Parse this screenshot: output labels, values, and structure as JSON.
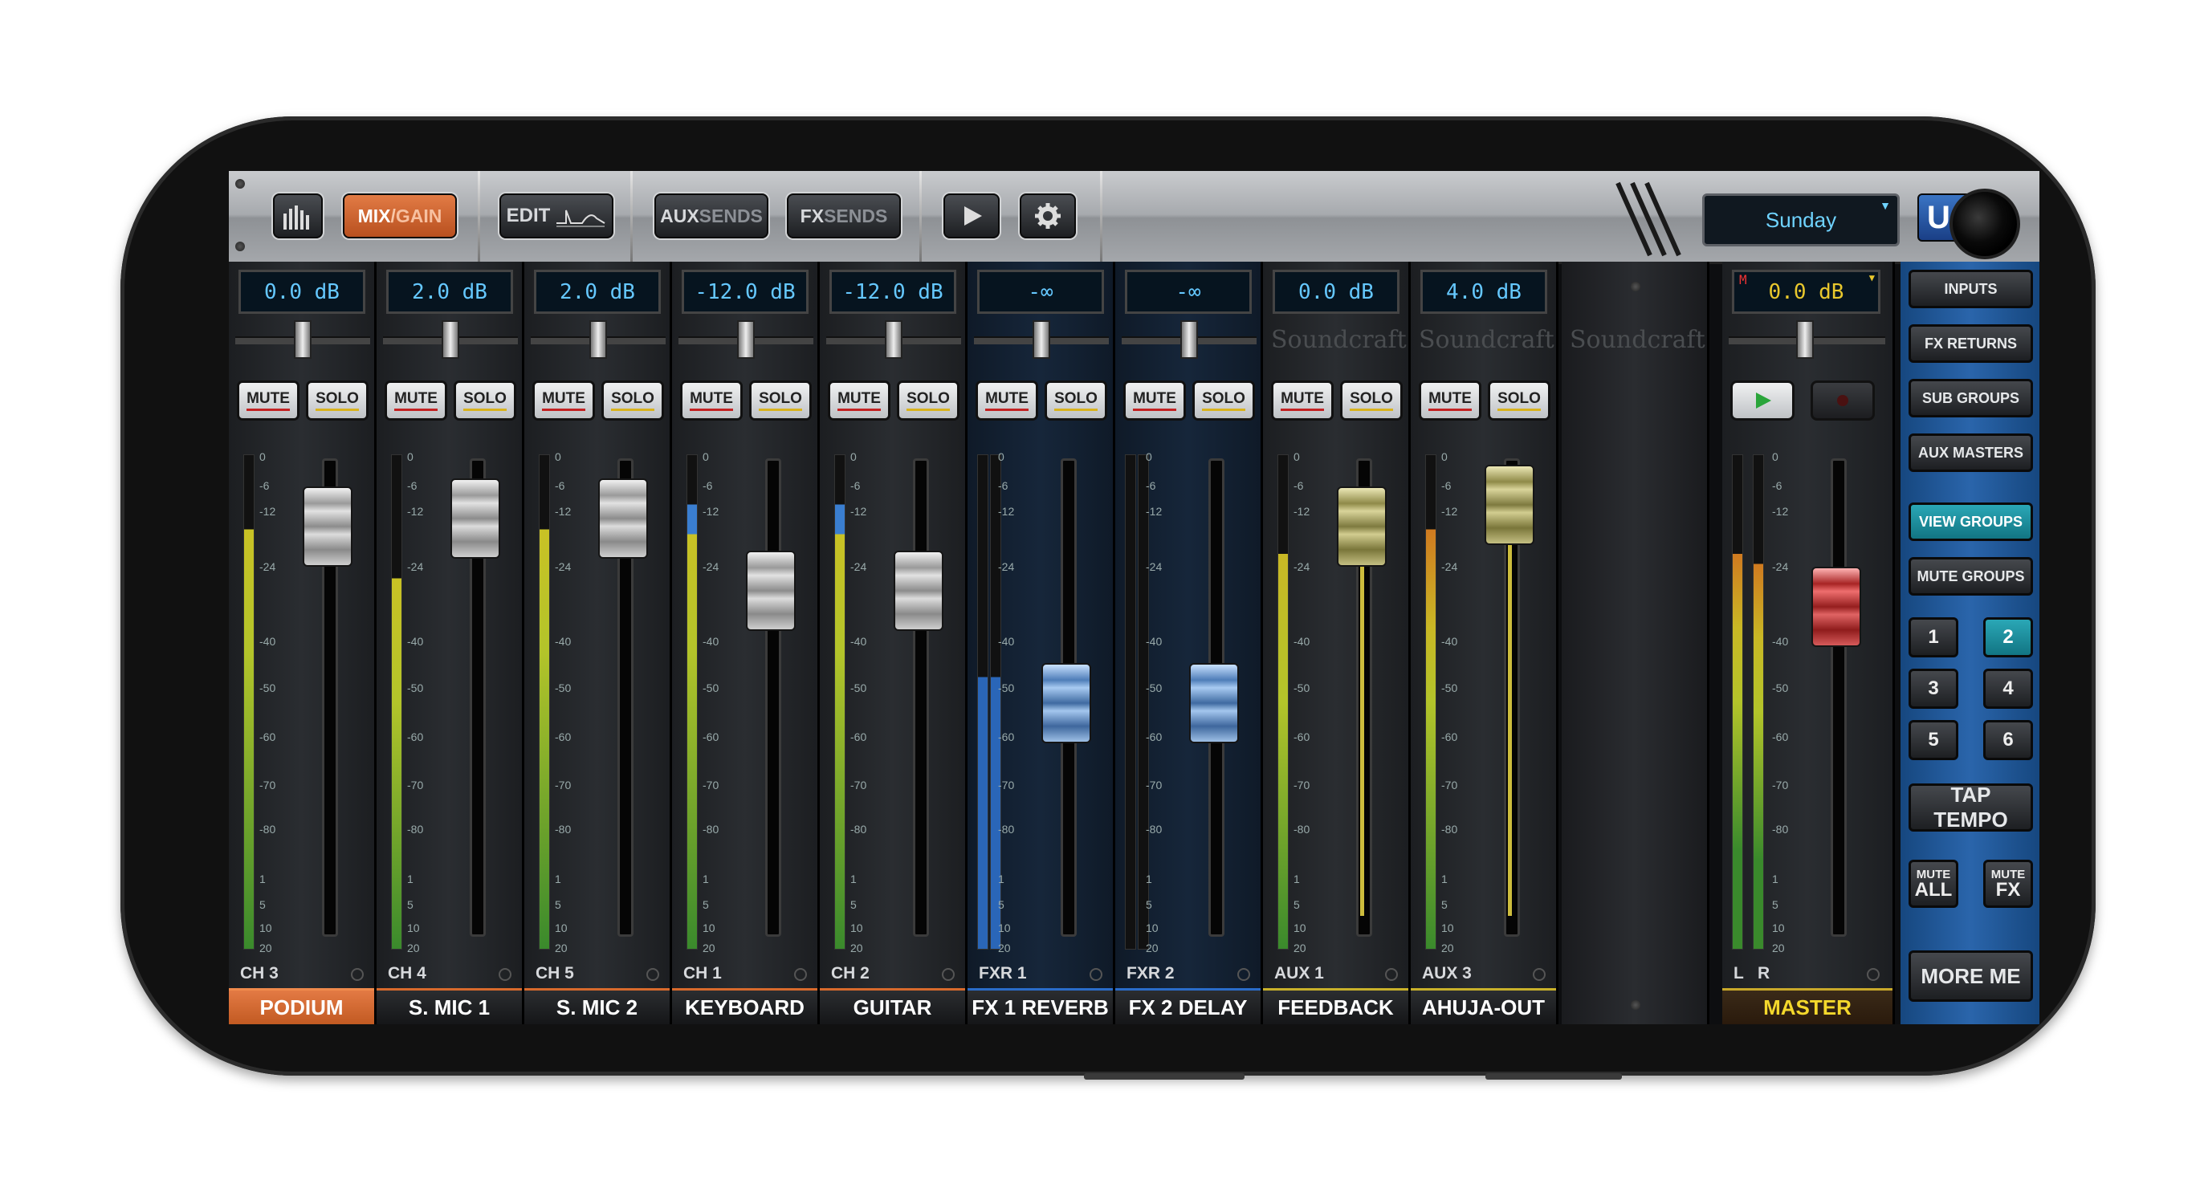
{
  "toolbar": {
    "mix_label": "MIX",
    "gain_label": "GAIN",
    "edit_label": "EDIT",
    "aux_label": "AUX",
    "aux_sends_label": "SENDS",
    "fx_label": "FX",
    "fx_sends_label": "SENDS",
    "snapshot": "Sunday"
  },
  "channels": [
    {
      "db": "0.0 dB",
      "id": "CH 3",
      "name": "PODIUM"
    },
    {
      "db": "2.0 dB",
      "id": "CH 4",
      "name": "S. MIC 1"
    },
    {
      "db": "2.0 dB",
      "id": "CH 5",
      "name": "S. MIC 2"
    },
    {
      "db": "-12.0 dB",
      "id": "CH 1",
      "name": "KEYBOARD"
    },
    {
      "db": "-12.0 dB",
      "id": "CH 2",
      "name": "GUITAR"
    },
    {
      "db": "-∞",
      "id": "FXR 1",
      "name": "FX 1 REVERB"
    },
    {
      "db": "-∞",
      "id": "FXR 2",
      "name": "FX 2 DELAY"
    },
    {
      "db": "0.0 dB",
      "id": "AUX 1",
      "name": "FEEDBACK"
    },
    {
      "db": "4.0 dB",
      "id": "AUX 3",
      "name": "AHUJA-OUT"
    }
  ],
  "buttons": {
    "mute": "MUTE",
    "solo": "SOLO"
  },
  "brand": "Soundcraft",
  "scale": [
    "0",
    "-6",
    "-12",
    "-24",
    "-40",
    "-50",
    "-60",
    "-70",
    "-80",
    "1",
    "5",
    "10",
    "20"
  ],
  "master": {
    "db": "0.0 dB",
    "m_flag": "M",
    "name": "MASTER",
    "left": "L",
    "right": "R"
  },
  "side": {
    "inputs": "INPUTS",
    "fx_returns": "FX RETURNS",
    "sub_groups": "SUB GROUPS",
    "aux_masters": "AUX MASTERS",
    "view_groups": "VIEW GROUPS",
    "mute_groups": "MUTE GROUPS",
    "groups": [
      "1",
      "2",
      "3",
      "4",
      "5",
      "6"
    ],
    "tap_tempo": "TAP TEMPO",
    "mute_all_a": "MUTE",
    "mute_all_b": "ALL",
    "mute_fx_a": "MUTE",
    "mute_fx_b": "FX",
    "more_me": "MORE ME"
  }
}
